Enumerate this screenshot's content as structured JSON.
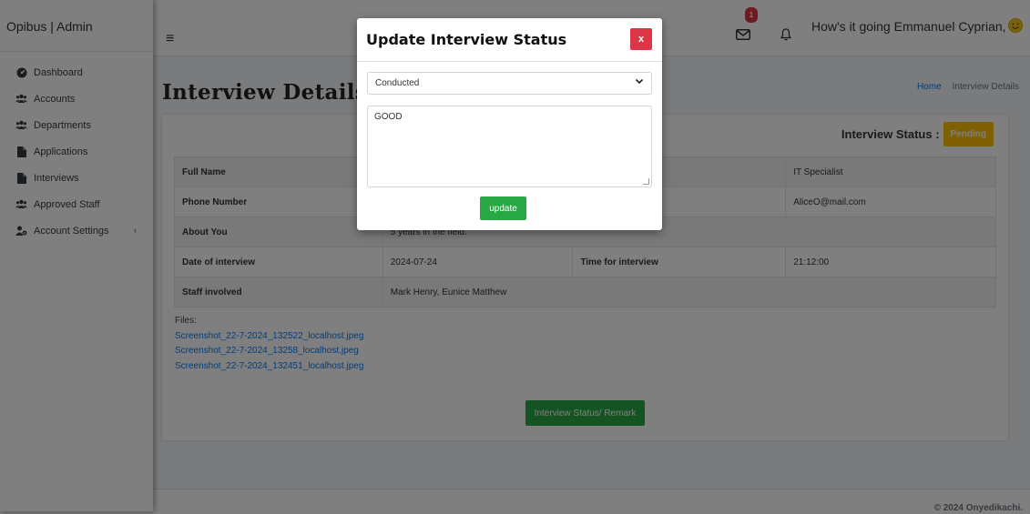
{
  "sidebar": {
    "brand": "Opibus | Admin",
    "items": [
      {
        "label": "Dashboard",
        "icon": "tachometer-icon"
      },
      {
        "label": "Accounts",
        "icon": "users-icon"
      },
      {
        "label": "Departments",
        "icon": "users-icon"
      },
      {
        "label": "Applications",
        "icon": "file-icon"
      },
      {
        "label": "Interviews",
        "icon": "file-icon"
      },
      {
        "label": "Approved Staff",
        "icon": "users-icon"
      },
      {
        "label": "Account Settings",
        "icon": "user-cog-icon",
        "caret": "‹"
      }
    ]
  },
  "topbar": {
    "menu_icon": "≡",
    "notification_count": "1",
    "greeting": "How's it going Emmanuel Cyprian,"
  },
  "page": {
    "title": "Interview Details",
    "breadcrumb": [
      "Home",
      "Interview Details"
    ]
  },
  "card": {
    "status_label": "Interview Status :",
    "status_value": "Pending",
    "rows": {
      "full_name_label": "Full Name",
      "role_value": "IT Specialist",
      "phone_label": "Phone Number",
      "email_value": "AliceO@mail.com",
      "about_label": "About You",
      "about_value": "5 years in the field.",
      "date_label": "Date of interview",
      "date_value": "2024-07-24",
      "time_label": "Time for interview",
      "time_value": "21:12:00",
      "staff_label": "Staff involved",
      "staff_value": "Mark Henry, Eunice Matthew"
    },
    "files_label": "Files:",
    "files": [
      "Screenshot_22-7-2024_132522_localhost.jpeg",
      "Screenshot_22-7-2024_13258_localhost.jpeg",
      "Screenshot_22-7-2024_132451_localhost.jpeg"
    ],
    "remark_button": "Interview Status/ Remark"
  },
  "footer": {
    "text": "© 2024 Onyedikachi."
  },
  "modal": {
    "title": "Update Interview Status",
    "close_label": "x",
    "select_value": "Conducted",
    "remark_text": "GOOD",
    "update_label": "update"
  },
  "colors": {
    "primary": "#007bff",
    "success": "#28a745",
    "warning": "#ffc107",
    "danger": "#dc3545"
  }
}
